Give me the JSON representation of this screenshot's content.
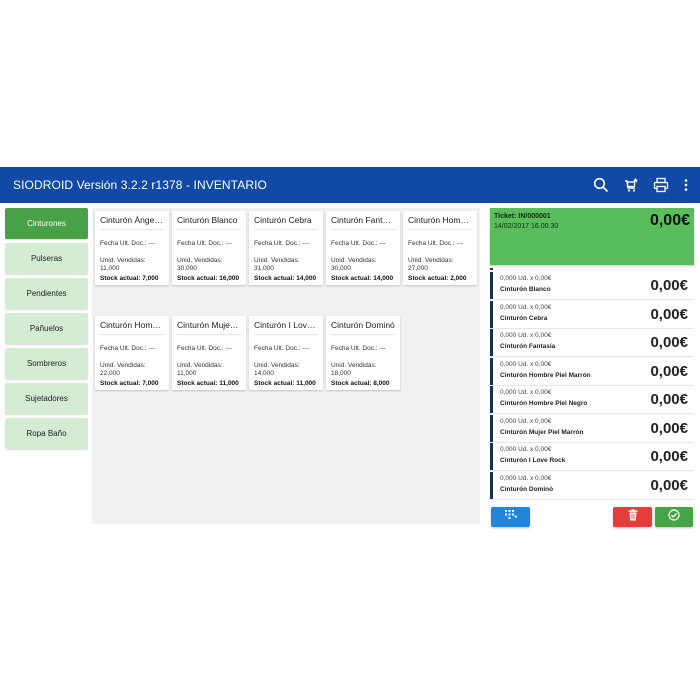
{
  "header": {
    "title": "SIODROID Versión 3.2.2 r1378 - INVENTARIO",
    "actions": [
      {
        "icon": "search-icon"
      },
      {
        "icon": "cart-star-icon"
      },
      {
        "icon": "print-icon"
      },
      {
        "icon": "more-vert-icon"
      }
    ]
  },
  "categories": [
    {
      "label": "Cinturones",
      "active": true
    },
    {
      "label": "Pulseras",
      "active": false
    },
    {
      "label": "Pendientes",
      "active": false
    },
    {
      "label": "Pañuelos",
      "active": false
    },
    {
      "label": "Sombreros",
      "active": false
    },
    {
      "label": "Sujetadores",
      "active": false
    },
    {
      "label": "Ropa Baño",
      "active": false
    }
  ],
  "products": [
    {
      "name": "Cinturón Ángeles",
      "fecha": "Fecha Ult. Doc.: ---",
      "uv_label": "Unid. Vendidas:",
      "uv_value": "11,000",
      "stock": "Stock actual: 7,000"
    },
    {
      "name": "Cinturón Blanco",
      "fecha": "Fecha Ult. Doc.: ---",
      "uv_label": "Unid. Vendidas:",
      "uv_value": "30,000",
      "stock": "Stock actual: 16,000"
    },
    {
      "name": "Cinturón Cebra",
      "fecha": "Fecha Ult. Doc.: ---",
      "uv_label": "Unid. Vendidas:",
      "uv_value": "31,000",
      "stock": "Stock actual: 14,000"
    },
    {
      "name": "Cinturón Fantasía",
      "fecha": "Fecha Ult. Doc.: ---",
      "uv_label": "Unid. Vendidas:",
      "uv_value": "30,000",
      "stock": "Stock actual: 14,000"
    },
    {
      "name": "Cinturón Hombre Piel Marrón",
      "fecha": "Fecha Ult. Doc.: ---",
      "uv_label": "Unid. Vendidas:",
      "uv_value": "27,000",
      "stock": "Stock actual: 2,000"
    },
    {
      "name": "Cinturón Hombre Piel Negro",
      "fecha": "Fecha Ult. Doc.: ---",
      "uv_label": "Unid. Vendidas:",
      "uv_value": "22,000",
      "stock": "Stock actual: 7,000"
    },
    {
      "name": "Cinturón Mujer Piel Marrón",
      "fecha": "Fecha Ult. Doc.: ---",
      "uv_label": "Unid. Vendidas:",
      "uv_value": "11,000",
      "stock": "Stock actual: 11,000"
    },
    {
      "name": "Cinturón I Love Rock",
      "fecha": "Fecha Ult. Doc.: ---",
      "uv_label": "Unid. Vendidas:",
      "uv_value": "14,000",
      "stock": "Stock actual: 11,000"
    },
    {
      "name": "Cinturón Dominó",
      "fecha": "Fecha Ult. Doc.: ---",
      "uv_label": "Unid. Vendidas:",
      "uv_value": "18,000",
      "stock": "Stock actual: 8,000"
    }
  ],
  "ticket": {
    "label": "Ticket: IN/000001",
    "date": "14/02/2017 16.00.30",
    "total": "0,00€"
  },
  "ticket_lines": [
    {
      "qty": "0,000 Ud. x 0,00€",
      "name": "Cinturón Blanco",
      "price": "0,00€"
    },
    {
      "qty": "0,000 Ud. x 0,00€",
      "name": "Cinturón Cebra",
      "price": "0,00€"
    },
    {
      "qty": "0,000 Ud. x 0,00€",
      "name": "Cinturón Fantasía",
      "price": "0,00€"
    },
    {
      "qty": "0,000 Ud. x 0,00€",
      "name": "Cinturón Hombre Piel Marrón",
      "price": "0,00€"
    },
    {
      "qty": "0,000 Ud. x 0,00€",
      "name": "Cinturón Hombre Piel Negro",
      "price": "0,00€"
    },
    {
      "qty": "0,000 Ud. x 0,00€",
      "name": "Cinturón Mujer Piel Marrón",
      "price": "0,00€"
    },
    {
      "qty": "0,000 Ud. x 0,00€",
      "name": "Cinturón I Love Rock",
      "price": "0,00€"
    },
    {
      "qty": "0,000 Ud. x 0,00€",
      "name": "Cinturón Dominó",
      "price": "0,00€"
    }
  ],
  "buttons": {
    "keypad_icon": "keypad-icon",
    "delete_icon": "trash-icon",
    "confirm_icon": "check-circle-icon"
  },
  "colors": {
    "appbar": "#1149a6",
    "category_active": "#48a047",
    "category_inactive": "#d4ecd4",
    "ticket_header": "#58bd5a",
    "button_blue": "#2186d9",
    "button_red": "#e63c3c",
    "button_green": "#46a346"
  }
}
